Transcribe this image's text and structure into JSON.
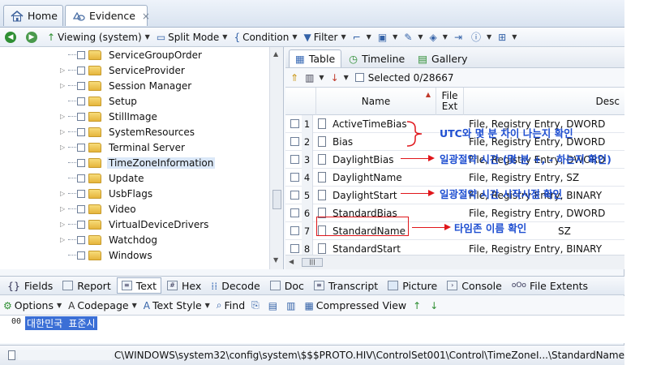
{
  "tabs": [
    {
      "label": "Home"
    },
    {
      "label": "Evidence",
      "close": "×"
    }
  ],
  "toolbar": {
    "viewing": "Viewing (system)",
    "split_mode": "Split Mode",
    "condition": "Condition",
    "filter": "Filter"
  },
  "tree": {
    "items": [
      {
        "label": "ServiceGroupOrder"
      },
      {
        "label": "ServiceProvider"
      },
      {
        "label": "Session Manager"
      },
      {
        "label": "Setup"
      },
      {
        "label": "StillImage"
      },
      {
        "label": "SystemResources"
      },
      {
        "label": "Terminal Server"
      },
      {
        "label": "TimeZoneInformation"
      },
      {
        "label": "Update"
      },
      {
        "label": "UsbFlags"
      },
      {
        "label": "Video"
      },
      {
        "label": "VirtualDeviceDrivers"
      },
      {
        "label": "Watchdog"
      },
      {
        "label": "Windows"
      }
    ]
  },
  "view_tabs": [
    "Table",
    "Timeline",
    "Gallery"
  ],
  "table": {
    "selected": "Selected 0/28667",
    "col_name": "Name",
    "col_ext": "File Ext",
    "col_desc": "Desc",
    "rows": [
      {
        "num": "1",
        "name": "ActiveTimeBias",
        "desc": "File, Registry Entry, DWORD"
      },
      {
        "num": "2",
        "name": "Bias",
        "desc": "File, Registry Entry, DWORD"
      },
      {
        "num": "3",
        "name": "DaylightBias",
        "desc": "File, Registry Entry, DWORD"
      },
      {
        "num": "4",
        "name": "DaylightName",
        "desc": "File, Registry Entry, SZ"
      },
      {
        "num": "5",
        "name": "DaylightStart",
        "desc": "File, Registry Entry, BINARY"
      },
      {
        "num": "6",
        "name": "StandardBias",
        "desc": "File, Registry Entry, DWORD"
      },
      {
        "num": "7",
        "name": "StandardName",
        "desc": "SZ"
      },
      {
        "num": "8",
        "name": "StandardStart",
        "desc": "File, Registry Entry, BINARY"
      }
    ]
  },
  "annotations": {
    "utc": "UTC와 몇 분 차이 나는지 확인",
    "daylight_bias": "일광절약 시간 (몇 분 +, - 하는지 확인)",
    "daylight_start": "일광절약 시간 시작시점 확인",
    "timezone": "타임존 이름 확인"
  },
  "bottom_tabs": [
    "Fields",
    "Report",
    "Text",
    "Hex",
    "Decode",
    "Doc",
    "Transcript",
    "Picture",
    "Console",
    "File Extents"
  ],
  "text_toolbar": [
    "Options",
    "Codepage",
    "Text Style",
    "Find",
    "Compressed View"
  ],
  "content": {
    "offset": "00",
    "text": "대한민국 표준시"
  },
  "status": {
    "path": "C\\WINDOWS\\system32\\config\\system\\$$$PROTO.HIV\\ControlSet001\\Control\\TimeZoneI...\\StandardName"
  },
  "colors": {
    "annotation_red": "#e0161b",
    "annotation_blue": "#1f4fd1",
    "selection": "#3b6fd6"
  }
}
